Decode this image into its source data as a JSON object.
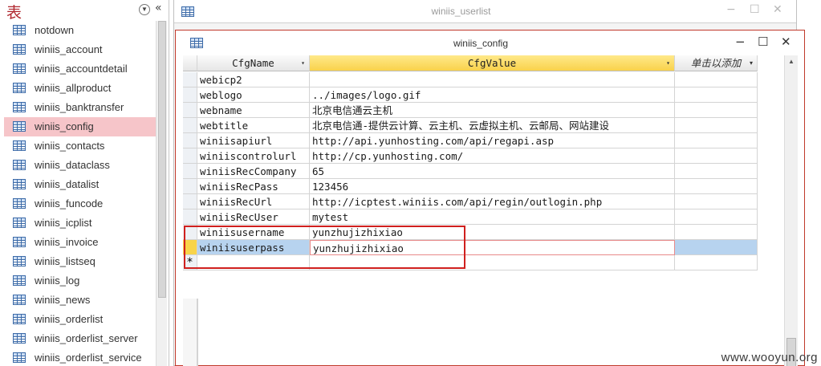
{
  "nav": {
    "title": "表",
    "menu_glyph": "▼",
    "collapse_glyph": "«",
    "items": [
      {
        "label": "notdown"
      },
      {
        "label": "winiis_account"
      },
      {
        "label": "winiis_accountdetail"
      },
      {
        "label": "winiis_allproduct"
      },
      {
        "label": "winiis_banktransfer"
      },
      {
        "label": "winiis_config",
        "selected": true
      },
      {
        "label": "winiis_contacts"
      },
      {
        "label": "winiis_dataclass"
      },
      {
        "label": "winiis_datalist"
      },
      {
        "label": "winiis_funcode"
      },
      {
        "label": "winiis_icplist"
      },
      {
        "label": "winiis_invoice"
      },
      {
        "label": "winiis_listseq"
      },
      {
        "label": "winiis_log"
      },
      {
        "label": "winiis_news"
      },
      {
        "label": "winiis_orderlist"
      },
      {
        "label": "winiis_orderlist_server"
      },
      {
        "label": "winiis_orderlist_service"
      }
    ]
  },
  "bg_window": {
    "title": "winiis_userlist",
    "minimize": "−",
    "restore": "☐",
    "close": "✕"
  },
  "cfg_window": {
    "title": "winiis_config",
    "minimize": "−",
    "restore": "☐",
    "close": "✕"
  },
  "grid": {
    "columns": {
      "name": "CfgName",
      "value": "CfgValue",
      "add": "单击以添加",
      "sort_glyph": "▾"
    },
    "rows": [
      {
        "name": "webicp2",
        "value": ""
      },
      {
        "name": "weblogo",
        "value": "../images/logo.gif"
      },
      {
        "name": "webname",
        "value": "北京电信通云主机"
      },
      {
        "name": "webtitle",
        "value": "北京电信通-提供云计算、云主机、云虚拟主机、云邮局、网站建设"
      },
      {
        "name": "winiisapiurl",
        "value": "http://api.yunhosting.com/api/regapi.asp"
      },
      {
        "name": "winiiscontrolurl",
        "value": "http://cp.yunhosting.com/"
      },
      {
        "name": "winiisRecCompany",
        "value": "65"
      },
      {
        "name": "winiisRecPass",
        "value": "123456"
      },
      {
        "name": "winiisRecUrl",
        "value": "http://icptest.winiis.com/api/regin/outlogin.php"
      },
      {
        "name": "winiisRecUser",
        "value": "mytest"
      },
      {
        "name": "winiisusername",
        "value": "yunzhujizhixiao"
      },
      {
        "name": "winiisuserpass",
        "value": "yunzhujizhixiao",
        "current": true
      }
    ],
    "new_row_marker": "*",
    "scroll_up_glyph": "▲"
  },
  "watermark": "www.wooyun.org",
  "colors": {
    "accent_red": "#d0201e",
    "selected_nav": "#f6c5c9",
    "header_value": "#f9d24b",
    "current_row": "#b7d3ef"
  }
}
